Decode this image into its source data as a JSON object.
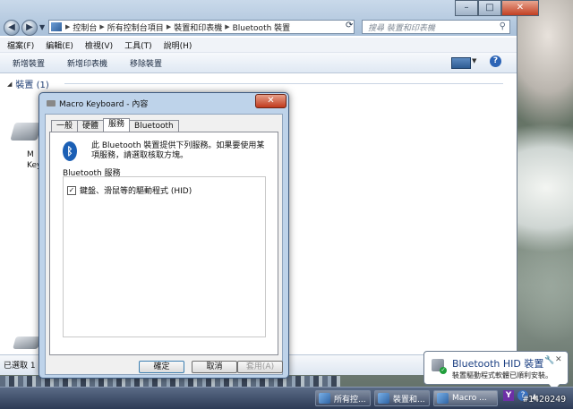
{
  "explorer": {
    "breadcrumbs": [
      "控制台",
      "所有控制台項目",
      "裝置和印表機",
      "Bluetooth 裝置"
    ],
    "search_placeholder": "搜尋 裝置和印表機",
    "menu": [
      "檔案(F)",
      "編輯(E)",
      "檢視(V)",
      "工具(T)",
      "說明(H)"
    ],
    "commands": [
      "新增裝置",
      "新增印表機",
      "移除裝置"
    ],
    "group_header": "裝置 (1)",
    "device_label_line1": "M",
    "device_label_line2": "Key",
    "status_text": "已選取 1"
  },
  "dialog": {
    "title": "Macro Keyboard - 內容",
    "tabs": [
      "一般",
      "硬體",
      "服務",
      "Bluetooth"
    ],
    "active_tab": "服務",
    "description": "此 Bluetooth 裝置提供下列服務。如果要使用某項服務，請選取核取方塊。",
    "services_label": "Bluetooth 服務",
    "services": [
      {
        "label": "鍵盤、滑鼠等的驅動程式 (HID)",
        "checked": true
      }
    ],
    "buttons": {
      "ok": "確定",
      "cancel": "取消",
      "apply": "套用(A)"
    }
  },
  "notification": {
    "title": "Bluetooth HID 裝置",
    "body": "裝置驅動程式軟體已順利安裝。"
  },
  "taskbar": {
    "items": [
      "所有控...",
      "裝置和...",
      "Macro ..."
    ]
  },
  "watermark": "#1420249"
}
